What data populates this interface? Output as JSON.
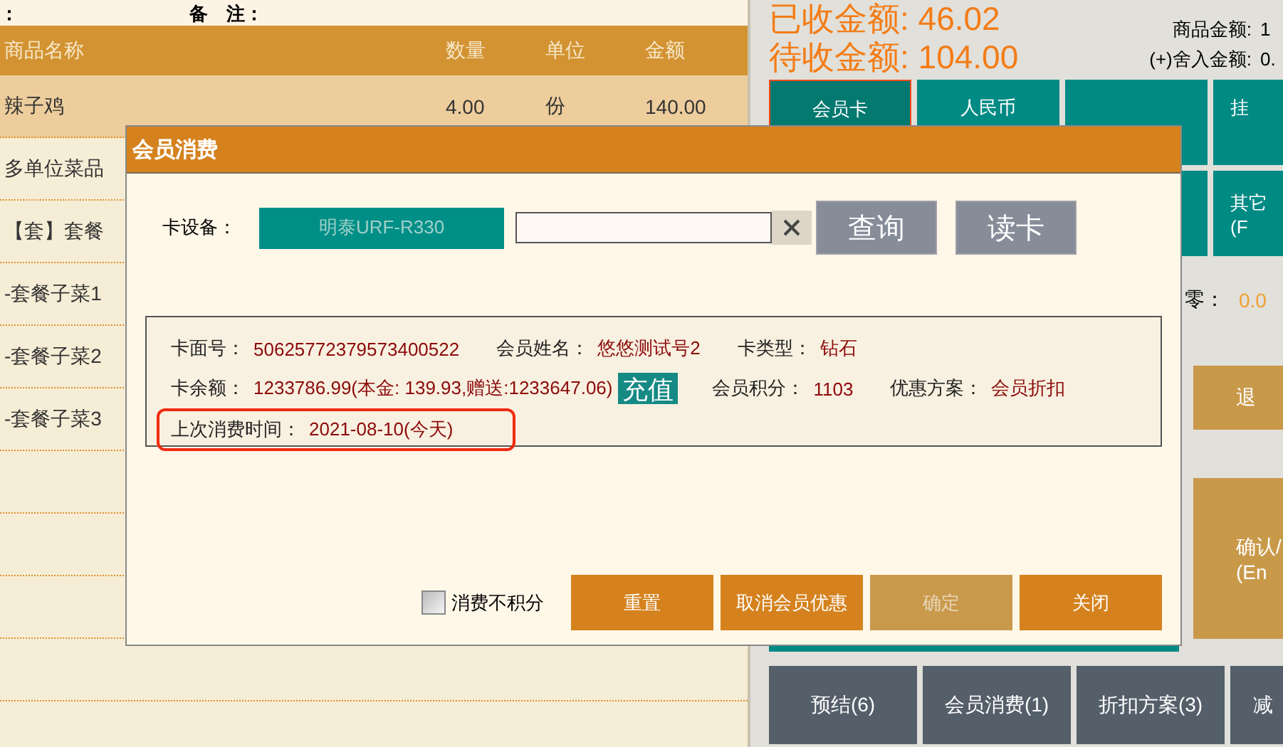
{
  "order": {
    "top_labels": [
      "：",
      "备　注："
    ],
    "columns": [
      "商品名称",
      "数量",
      "单位",
      "金额"
    ],
    "rows": [
      {
        "name": "辣子鸡",
        "qty": "4.00",
        "unit": "份",
        "amount": "140.00",
        "selected": true
      },
      {
        "name": "多单位菜品",
        "selected": false
      },
      {
        "name": "【套】套餐",
        "selected": false
      },
      {
        "name": "-套餐子菜1",
        "selected": false
      },
      {
        "name": "-套餐子菜2",
        "selected": false
      },
      {
        "name": "-套餐子菜3",
        "selected": false
      },
      {
        "selected": false
      },
      {
        "selected": false
      },
      {
        "selected": false
      },
      {
        "selected": false
      }
    ]
  },
  "summary": {
    "received": "已收金额: 46.02",
    "pending": "待收金额: 104.00",
    "details": [
      {
        "label": "商品金额:",
        "value": "1"
      },
      {
        "label": "(+)舍入金额:",
        "value": "0."
      }
    ]
  },
  "payment_buttons": [
    {
      "kind": "tile",
      "label": "会员卡",
      "selected": true
    },
    {
      "kind": "tile",
      "label": "人民币",
      "selected": false
    },
    {
      "kind": "tile",
      "selected": false
    },
    {
      "kind": "tile",
      "label": "挂",
      "selected": false
    },
    {
      "kind": "tile",
      "selected": false
    },
    {
      "kind": "tile",
      "label": "其它",
      "sub": "(F",
      "selected": false
    }
  ],
  "change": {
    "label": "零：",
    "value": "0.0"
  },
  "side_buttons": [
    {
      "label": "退"
    },
    {
      "label": "确认/",
      "sub": "(En"
    }
  ],
  "bottom_buttons": [
    "预结(6)",
    "会员消费(1)",
    "折扣方案(3)",
    "减"
  ],
  "dialog": {
    "title": "会员消费",
    "device_label": "卡设备：",
    "device": "明泰URF-R330",
    "search_button": "查询",
    "read_button": "读卡",
    "info_rows": [
      [
        {
          "kind": "field",
          "label": "卡面号：",
          "value": "50625772379573400522"
        },
        {
          "kind": "field",
          "label": "会员姓名：",
          "value": "悠悠测试号2"
        },
        {
          "kind": "field",
          "label": "卡类型：",
          "value": "钻石"
        }
      ],
      [
        {
          "kind": "field",
          "label": "卡余额：",
          "value": "1233786.99(本金: 139.93,赠送:1233647.06)"
        },
        {
          "kind": "button",
          "label": "充值"
        },
        {
          "kind": "field",
          "label": "会员积分：",
          "value": "1103"
        },
        {
          "kind": "field",
          "label": "优惠方案：",
          "value": "会员折扣"
        }
      ]
    ],
    "last_visit": {
      "label": "上次消费时间：",
      "value": "2021-08-10(今天)",
      "highlighted": true
    },
    "no_points": {
      "label": "消费不积分",
      "checked": false
    },
    "buttons": [
      {
        "label": "重置",
        "disabled": false
      },
      {
        "label": "取消会员优惠",
        "disabled": false
      },
      {
        "label": "确定",
        "disabled": true
      },
      {
        "label": "关闭",
        "disabled": false
      }
    ]
  }
}
